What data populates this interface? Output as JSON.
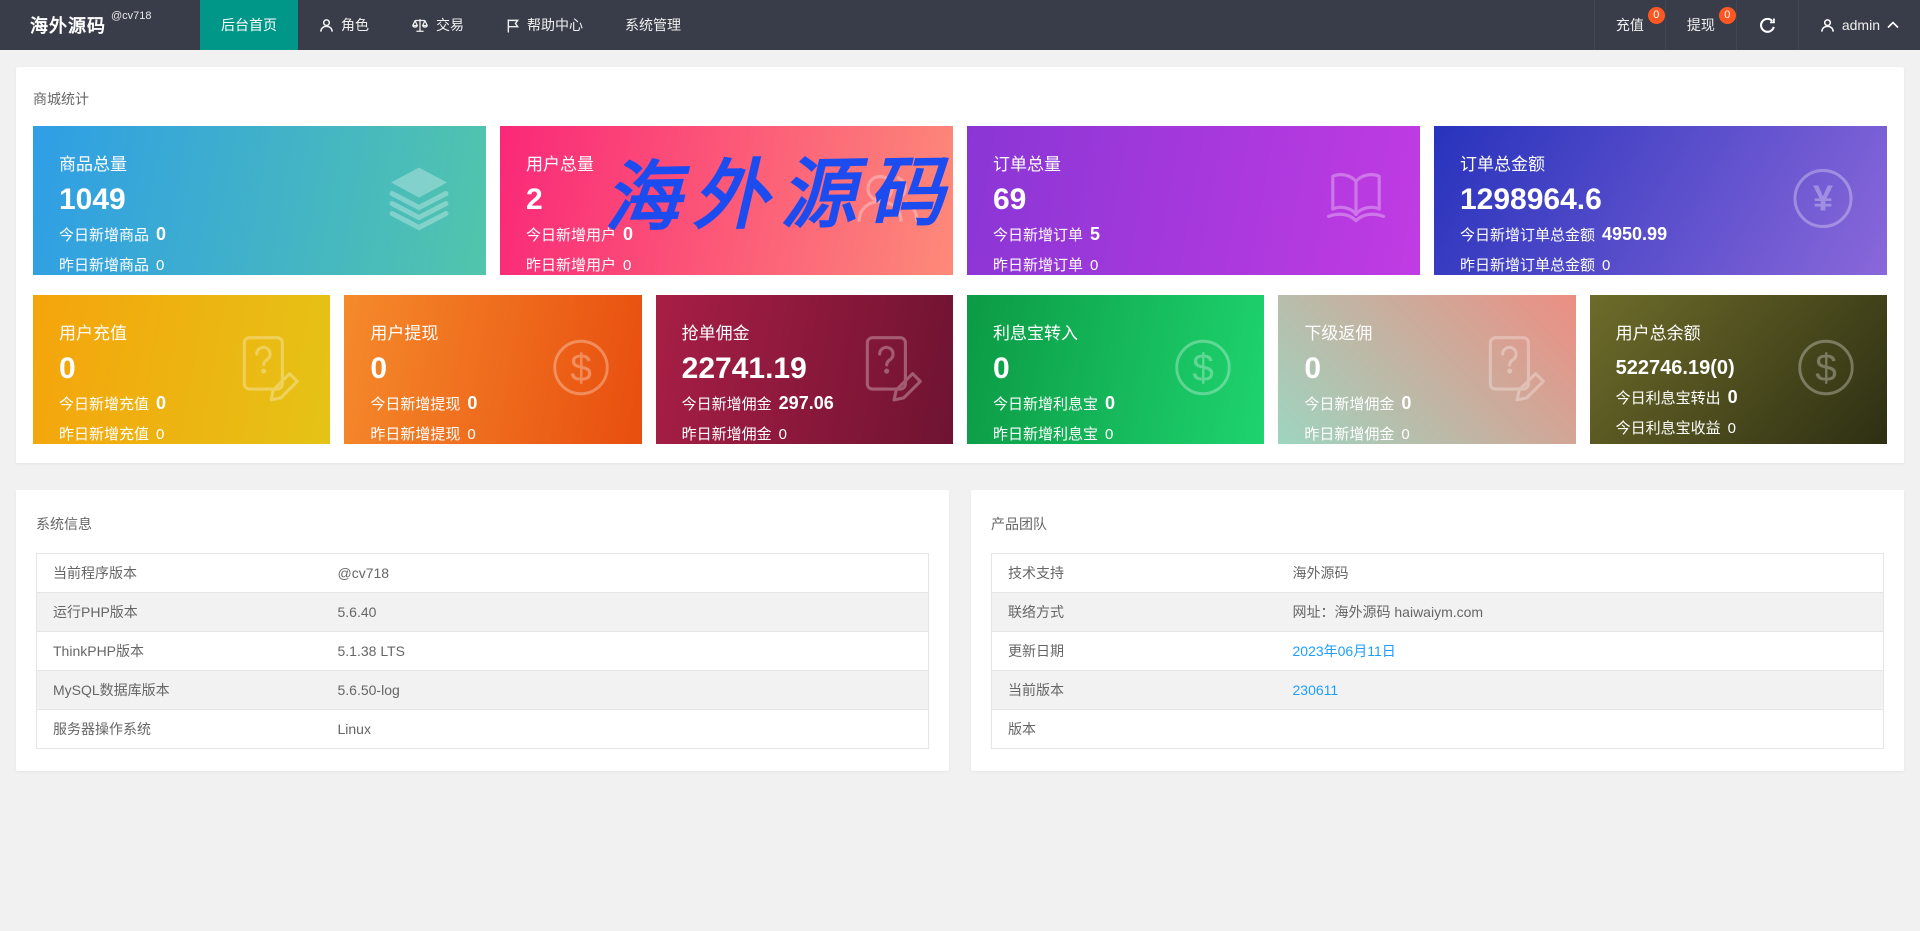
{
  "colors": {
    "navbar": "#393D49",
    "active_tab": "#009688",
    "badge": "#FF5722",
    "link": "#1E9FFF",
    "watermark_blue": "#1C4BF0"
  },
  "navbar": {
    "logo": "海外源码",
    "logo_sup": "@cv718",
    "items": [
      {
        "label": "后台首页",
        "icon": "none",
        "active": true
      },
      {
        "label": "角色",
        "icon": "user"
      },
      {
        "label": "交易",
        "icon": "scales"
      },
      {
        "label": "帮助中心",
        "icon": "flag"
      },
      {
        "label": "系统管理",
        "icon": "none"
      }
    ],
    "right": {
      "recharge": {
        "label": "充值",
        "badge": "0"
      },
      "withdraw": {
        "label": "提现",
        "badge": "0"
      },
      "refresh_icon": "refresh-icon",
      "user": {
        "label": "admin",
        "icon": "user",
        "caret": "chevron-up"
      }
    }
  },
  "stats": {
    "title": "商城统计",
    "watermark": "海外源码",
    "row1": [
      {
        "title": "商品总量",
        "value": "1049",
        "sub1_label": "今日新增商品",
        "sub1_value": "0",
        "sub2_label": "昨日新增商品",
        "sub2_value": "0",
        "icon": "layers"
      },
      {
        "title": "用户总量",
        "value": "2",
        "sub1_label": "今日新增用户",
        "sub1_value": "0",
        "sub2_label": "昨日新增用户",
        "sub2_value": "0",
        "icon": "users"
      },
      {
        "title": "订单总量",
        "value": "69",
        "sub1_label": "今日新增订单",
        "sub1_value": "5",
        "sub2_label": "昨日新增订单",
        "sub2_value": "0",
        "icon": "open-book"
      },
      {
        "title": "订单总金额",
        "value": "1298964.6",
        "sub1_label": "今日新增订单总金额",
        "sub1_value": "4950.99",
        "sub2_label": "昨日新增订单总金额",
        "sub2_value": "0",
        "icon": "yen-circle"
      }
    ],
    "row2": [
      {
        "title": "用户充值",
        "value": "0",
        "sub1_label": "今日新增充值",
        "sub1_value": "0",
        "sub2_label": "昨日新增充值",
        "sub2_value": "0",
        "icon": "doc-question-pencil"
      },
      {
        "title": "用户提现",
        "value": "0",
        "sub1_label": "今日新增提现",
        "sub1_value": "0",
        "sub2_label": "昨日新增提现",
        "sub2_value": "0",
        "icon": "dollar-circle"
      },
      {
        "title": "抢单佣金",
        "value": "22741.19",
        "sub1_label": "今日新增佣金",
        "sub1_value": "297.06",
        "sub2_label": "昨日新增佣金",
        "sub2_value": "0",
        "icon": "doc-question-pencil"
      },
      {
        "title": "利息宝转入",
        "value": "0",
        "sub1_label": "今日新增利息宝",
        "sub1_value": "0",
        "sub2_label": "昨日新增利息宝",
        "sub2_value": "0",
        "icon": "dollar-circle"
      },
      {
        "title": "下级返佣",
        "value": "0",
        "sub1_label": "今日新增佣金",
        "sub1_value": "0",
        "sub2_label": "昨日新增佣金",
        "sub2_value": "0",
        "icon": "doc-question-pencil"
      },
      {
        "title": "用户总余额",
        "value": "522746.19(0)",
        "sub1_label": "今日利息宝转出",
        "sub1_value": "0",
        "sub2_label": "今日利息宝收益",
        "sub2_value": "0",
        "icon": "dollar-circle"
      }
    ]
  },
  "system_info": {
    "title": "系统信息",
    "rows": [
      {
        "label": "当前程序版本",
        "value": "@cv718"
      },
      {
        "label": "运行PHP版本",
        "value": "5.6.40"
      },
      {
        "label": "ThinkPHP版本",
        "value": "5.1.38 LTS"
      },
      {
        "label": "MySQL数据库版本",
        "value": "5.6.50-log"
      },
      {
        "label": "服务器操作系统",
        "value": "Linux"
      }
    ]
  },
  "product_team": {
    "title": "产品团队",
    "rows": [
      {
        "label": "技术支持",
        "value": "海外源码"
      },
      {
        "label": "联络方式",
        "value": "网址：海外源码 haiwaiym.com"
      },
      {
        "label": "更新日期",
        "value": "2023年06月11日"
      },
      {
        "label": "当前版本",
        "value": "230611"
      },
      {
        "label": "版本",
        "value": ""
      }
    ]
  }
}
